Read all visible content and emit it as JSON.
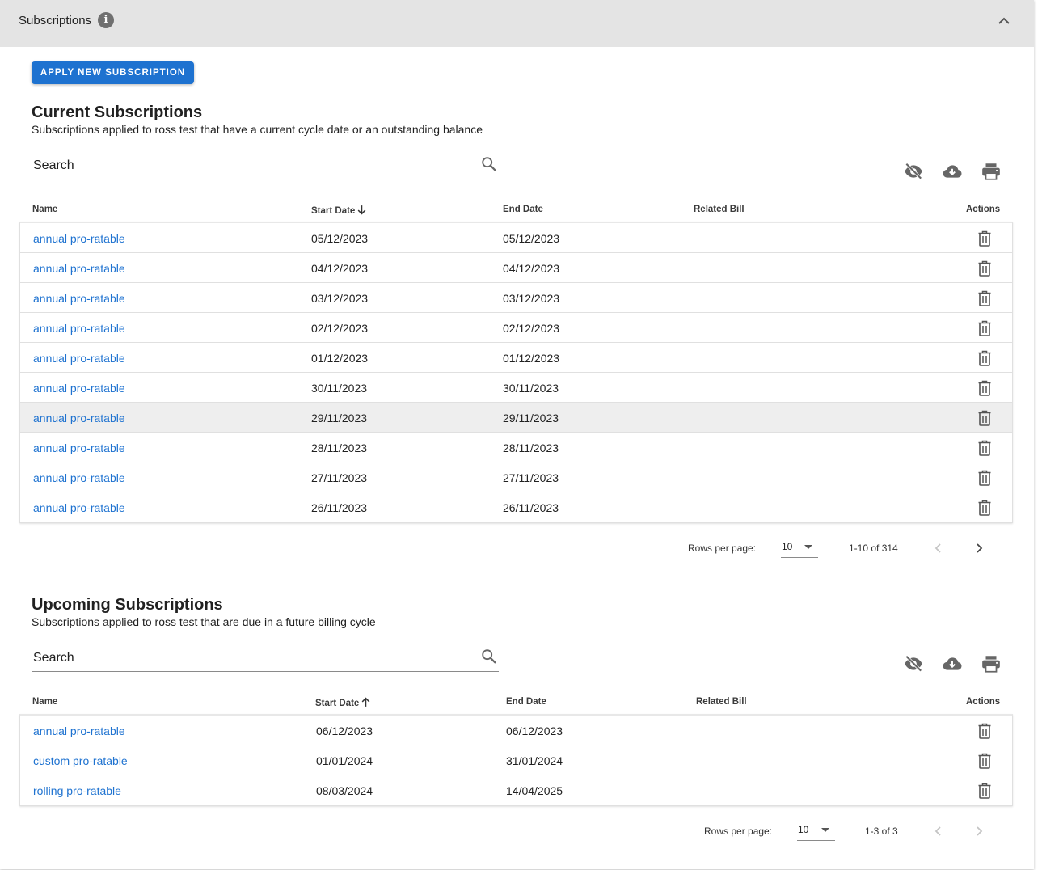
{
  "panel": {
    "title": "Subscriptions",
    "info_glyph": "i"
  },
  "apply_button": "APPLY NEW SUBSCRIPTION",
  "current": {
    "title": "Current Subscriptions",
    "subtitle": "Subscriptions applied to ross test that have a current cycle date or an outstanding balance",
    "search_placeholder": "Search",
    "columns": {
      "name": "Name",
      "start": "Start Date",
      "end": "End Date",
      "bill": "Related Bill",
      "actions": "Actions"
    },
    "rows": [
      {
        "name": "annual pro-ratable",
        "start": "05/12/2023",
        "end": "05/12/2023",
        "bill": ""
      },
      {
        "name": "annual pro-ratable",
        "start": "04/12/2023",
        "end": "04/12/2023",
        "bill": ""
      },
      {
        "name": "annual pro-ratable",
        "start": "03/12/2023",
        "end": "03/12/2023",
        "bill": ""
      },
      {
        "name": "annual pro-ratable",
        "start": "02/12/2023",
        "end": "02/12/2023",
        "bill": ""
      },
      {
        "name": "annual pro-ratable",
        "start": "01/12/2023",
        "end": "01/12/2023",
        "bill": ""
      },
      {
        "name": "annual pro-ratable",
        "start": "30/11/2023",
        "end": "30/11/2023",
        "bill": ""
      },
      {
        "name": "annual pro-ratable",
        "start": "29/11/2023",
        "end": "29/11/2023",
        "bill": ""
      },
      {
        "name": "annual pro-ratable",
        "start": "28/11/2023",
        "end": "28/11/2023",
        "bill": ""
      },
      {
        "name": "annual pro-ratable",
        "start": "27/11/2023",
        "end": "27/11/2023",
        "bill": ""
      },
      {
        "name": "annual pro-ratable",
        "start": "26/11/2023",
        "end": "26/11/2023",
        "bill": ""
      }
    ],
    "highlighted_row": 6,
    "pagination": {
      "rows_label": "Rows per page:",
      "rows_value": "10",
      "range": "1-10 of 314"
    }
  },
  "upcoming": {
    "title": "Upcoming Subscriptions",
    "subtitle": "Subscriptions applied to ross test that are due in a future billing cycle",
    "search_placeholder": "Search",
    "columns": {
      "name": "Name",
      "start": "Start Date",
      "end": "End Date",
      "bill": "Related Bill",
      "actions": "Actions"
    },
    "rows": [
      {
        "name": "annual pro-ratable",
        "start": "06/12/2023",
        "end": "06/12/2023",
        "bill": ""
      },
      {
        "name": "custom pro-ratable",
        "start": "01/01/2024",
        "end": "31/01/2024",
        "bill": ""
      },
      {
        "name": "rolling pro-ratable",
        "start": "08/03/2024",
        "end": "14/04/2025",
        "bill": ""
      }
    ],
    "pagination": {
      "rows_label": "Rows per page:",
      "rows_value": "10",
      "range": "1-3 of 3"
    }
  },
  "colors": {
    "primary": "#1e72d0",
    "header_bg": "#e4e4e4",
    "icon_gray": "#666666",
    "row_highlight": "#eeeeee"
  },
  "icons": {
    "info": "info-icon",
    "collapse": "chevron-up-icon",
    "search": "search-icon",
    "hide_columns": "eye-off-icon",
    "download": "cloud-download-icon",
    "print": "printer-icon",
    "delete": "trash-icon",
    "sort_desc": "arrow-down-icon",
    "sort_asc": "arrow-up-icon",
    "prev": "chevron-left-icon",
    "next": "chevron-right-icon"
  }
}
